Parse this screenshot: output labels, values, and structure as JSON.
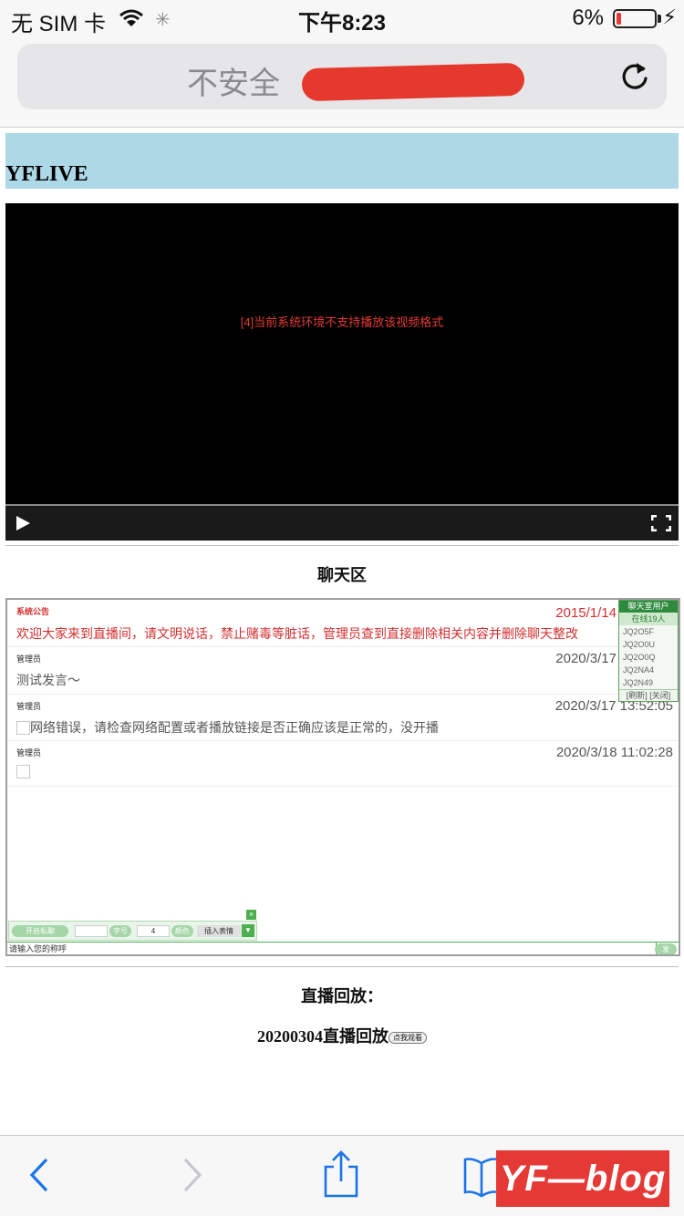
{
  "status_bar": {
    "carrier": "无 SIM 卡",
    "time": "下午8:23",
    "battery": "6%",
    "battery_level": 0.06
  },
  "address_bar": {
    "security_label": "不安全"
  },
  "page": {
    "site_title": "YFLIVE",
    "player": {
      "error_message": "[4]当前系统环境不支持播放该视频格式"
    },
    "chat": {
      "section_title": "聊天区",
      "messages": [
        {
          "sender": "系统公告",
          "date": "2015/1/14",
          "text": "欢迎大家来到直播间，请文明说话，禁止赌毒等脏话，管理员查到直接删除相关内容并删除聊天整改"
        },
        {
          "sender": "管理员",
          "date": "2020/3/17",
          "date_tail": "7",
          "text": "测试发言～"
        },
        {
          "sender": "管理员",
          "date": "2020/3/17 13:52:05",
          "text": "网络错误，请检查网络配置或者播放链接是否正确应该是正常的，没开播"
        },
        {
          "sender": "管理员",
          "date": "2020/3/18 11:02:28",
          "text": ""
        }
      ],
      "user_panel": {
        "header": "聊天室用户",
        "online": "在线19人",
        "users": [
          "JQ2O5F",
          "JQ2O0U",
          "JQ2O0Q",
          "JQ2NA4",
          "JQ2N49"
        ],
        "footer": "[刷新] [关闭]"
      },
      "toolbar": {
        "close": "×",
        "open_private": "开启私聊",
        "font_button": "字号",
        "font_size": "4",
        "color_button": "颜色",
        "emoji_button": "插入表情",
        "dropdown": "▼"
      },
      "nickname_placeholder": "请输入您的称呼",
      "send_button": "发"
    },
    "replay": {
      "title": "直播回放：",
      "item_label": "20200304直播回放",
      "watch_button": "点我观看"
    }
  },
  "watermark": "YF—blog"
}
